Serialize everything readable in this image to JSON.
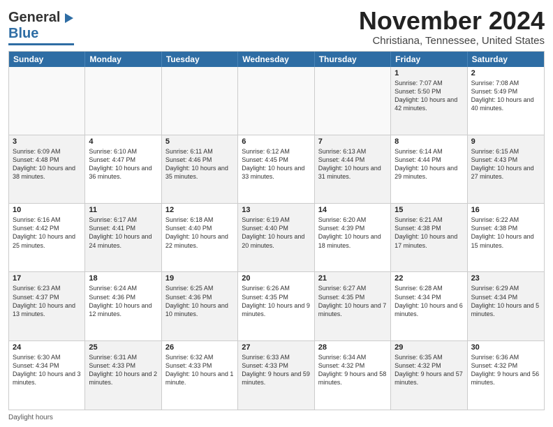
{
  "header": {
    "logo_general": "General",
    "logo_blue": "Blue",
    "month_title": "November 2024",
    "subtitle": "Christiana, Tennessee, United States"
  },
  "day_headers": [
    "Sunday",
    "Monday",
    "Tuesday",
    "Wednesday",
    "Thursday",
    "Friday",
    "Saturday"
  ],
  "weeks": [
    [
      {
        "day": "",
        "info": "",
        "empty": true
      },
      {
        "day": "",
        "info": "",
        "empty": true
      },
      {
        "day": "",
        "info": "",
        "empty": true
      },
      {
        "day": "",
        "info": "",
        "empty": true
      },
      {
        "day": "",
        "info": "",
        "empty": true
      },
      {
        "day": "1",
        "info": "Sunrise: 7:07 AM\nSunset: 5:50 PM\nDaylight: 10 hours and 42 minutes.",
        "shaded": true
      },
      {
        "day": "2",
        "info": "Sunrise: 7:08 AM\nSunset: 5:49 PM\nDaylight: 10 hours and 40 minutes.",
        "shaded": false
      }
    ],
    [
      {
        "day": "3",
        "info": "Sunrise: 6:09 AM\nSunset: 4:48 PM\nDaylight: 10 hours and 38 minutes.",
        "shaded": true
      },
      {
        "day": "4",
        "info": "Sunrise: 6:10 AM\nSunset: 4:47 PM\nDaylight: 10 hours and 36 minutes.",
        "shaded": false
      },
      {
        "day": "5",
        "info": "Sunrise: 6:11 AM\nSunset: 4:46 PM\nDaylight: 10 hours and 35 minutes.",
        "shaded": true
      },
      {
        "day": "6",
        "info": "Sunrise: 6:12 AM\nSunset: 4:45 PM\nDaylight: 10 hours and 33 minutes.",
        "shaded": false
      },
      {
        "day": "7",
        "info": "Sunrise: 6:13 AM\nSunset: 4:44 PM\nDaylight: 10 hours and 31 minutes.",
        "shaded": true
      },
      {
        "day": "8",
        "info": "Sunrise: 6:14 AM\nSunset: 4:44 PM\nDaylight: 10 hours and 29 minutes.",
        "shaded": false
      },
      {
        "day": "9",
        "info": "Sunrise: 6:15 AM\nSunset: 4:43 PM\nDaylight: 10 hours and 27 minutes.",
        "shaded": true
      }
    ],
    [
      {
        "day": "10",
        "info": "Sunrise: 6:16 AM\nSunset: 4:42 PM\nDaylight: 10 hours and 25 minutes.",
        "shaded": false
      },
      {
        "day": "11",
        "info": "Sunrise: 6:17 AM\nSunset: 4:41 PM\nDaylight: 10 hours and 24 minutes.",
        "shaded": true
      },
      {
        "day": "12",
        "info": "Sunrise: 6:18 AM\nSunset: 4:40 PM\nDaylight: 10 hours and 22 minutes.",
        "shaded": false
      },
      {
        "day": "13",
        "info": "Sunrise: 6:19 AM\nSunset: 4:40 PM\nDaylight: 10 hours and 20 minutes.",
        "shaded": true
      },
      {
        "day": "14",
        "info": "Sunrise: 6:20 AM\nSunset: 4:39 PM\nDaylight: 10 hours and 18 minutes.",
        "shaded": false
      },
      {
        "day": "15",
        "info": "Sunrise: 6:21 AM\nSunset: 4:38 PM\nDaylight: 10 hours and 17 minutes.",
        "shaded": true
      },
      {
        "day": "16",
        "info": "Sunrise: 6:22 AM\nSunset: 4:38 PM\nDaylight: 10 hours and 15 minutes.",
        "shaded": false
      }
    ],
    [
      {
        "day": "17",
        "info": "Sunrise: 6:23 AM\nSunset: 4:37 PM\nDaylight: 10 hours and 13 minutes.",
        "shaded": true
      },
      {
        "day": "18",
        "info": "Sunrise: 6:24 AM\nSunset: 4:36 PM\nDaylight: 10 hours and 12 minutes.",
        "shaded": false
      },
      {
        "day": "19",
        "info": "Sunrise: 6:25 AM\nSunset: 4:36 PM\nDaylight: 10 hours and 10 minutes.",
        "shaded": true
      },
      {
        "day": "20",
        "info": "Sunrise: 6:26 AM\nSunset: 4:35 PM\nDaylight: 10 hours and 9 minutes.",
        "shaded": false
      },
      {
        "day": "21",
        "info": "Sunrise: 6:27 AM\nSunset: 4:35 PM\nDaylight: 10 hours and 7 minutes.",
        "shaded": true
      },
      {
        "day": "22",
        "info": "Sunrise: 6:28 AM\nSunset: 4:34 PM\nDaylight: 10 hours and 6 minutes.",
        "shaded": false
      },
      {
        "day": "23",
        "info": "Sunrise: 6:29 AM\nSunset: 4:34 PM\nDaylight: 10 hours and 5 minutes.",
        "shaded": true
      }
    ],
    [
      {
        "day": "24",
        "info": "Sunrise: 6:30 AM\nSunset: 4:34 PM\nDaylight: 10 hours and 3 minutes.",
        "shaded": false
      },
      {
        "day": "25",
        "info": "Sunrise: 6:31 AM\nSunset: 4:33 PM\nDaylight: 10 hours and 2 minutes.",
        "shaded": true
      },
      {
        "day": "26",
        "info": "Sunrise: 6:32 AM\nSunset: 4:33 PM\nDaylight: 10 hours and 1 minute.",
        "shaded": false
      },
      {
        "day": "27",
        "info": "Sunrise: 6:33 AM\nSunset: 4:33 PM\nDaylight: 9 hours and 59 minutes.",
        "shaded": true
      },
      {
        "day": "28",
        "info": "Sunrise: 6:34 AM\nSunset: 4:32 PM\nDaylight: 9 hours and 58 minutes.",
        "shaded": false
      },
      {
        "day": "29",
        "info": "Sunrise: 6:35 AM\nSunset: 4:32 PM\nDaylight: 9 hours and 57 minutes.",
        "shaded": true
      },
      {
        "day": "30",
        "info": "Sunrise: 6:36 AM\nSunset: 4:32 PM\nDaylight: 9 hours and 56 minutes.",
        "shaded": false
      }
    ]
  ],
  "footer": {
    "daylight_hours": "Daylight hours"
  }
}
